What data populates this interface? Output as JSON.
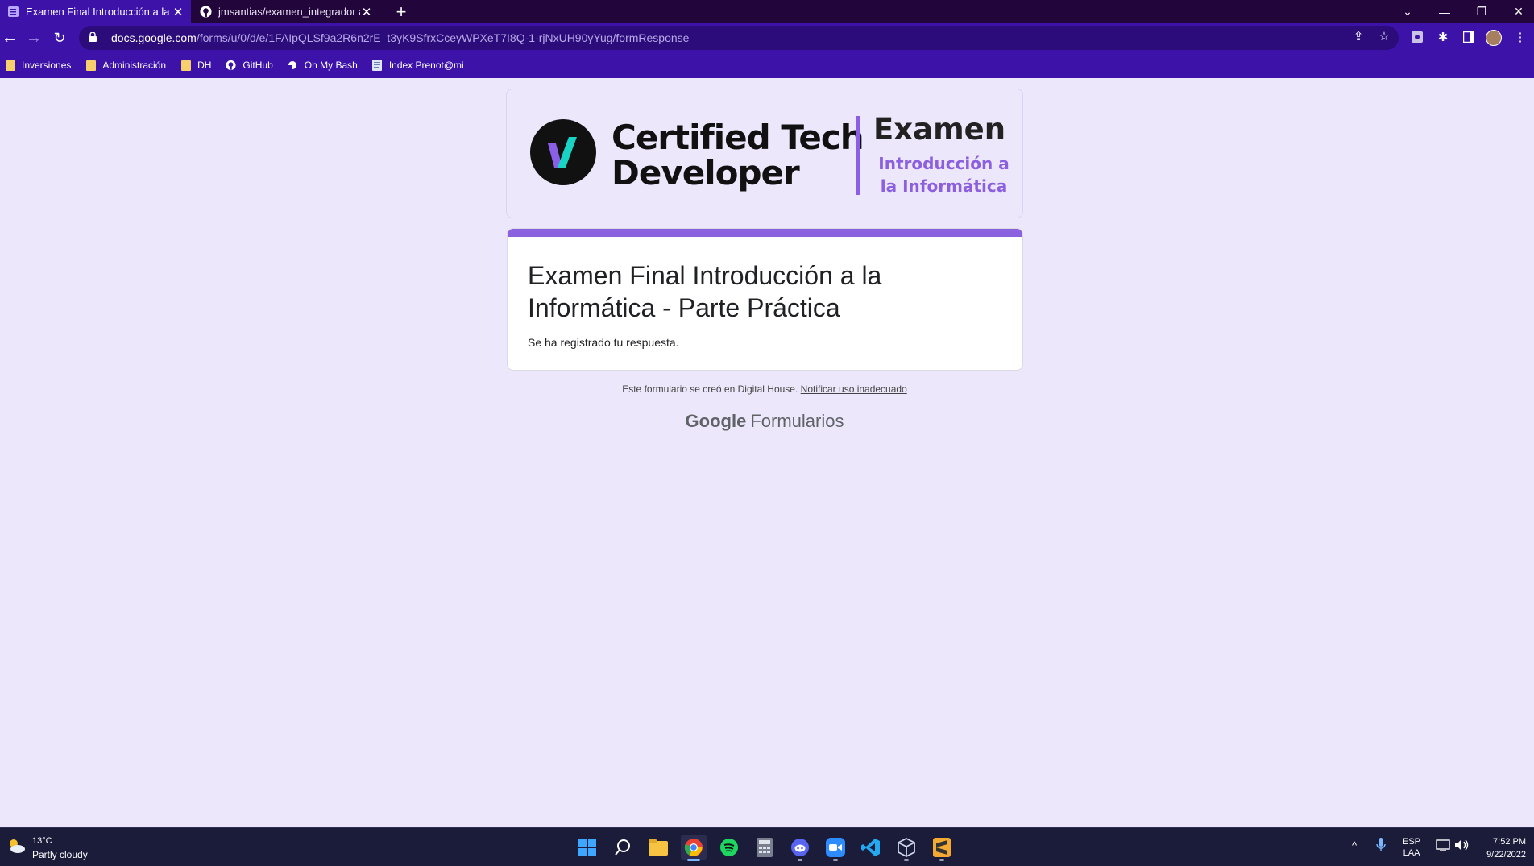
{
  "browser": {
    "tabs": [
      {
        "title": "Examen Final Introducción a la In",
        "icon": "google-forms-icon",
        "active": true
      },
      {
        "title": "jmsantias/examen_integrador at ",
        "icon": "github-icon",
        "active": false
      }
    ],
    "address": {
      "host": "docs.google.com",
      "path": "/forms/u/0/d/e/1FAIpQLSf9a2R6n2rE_t3yK9SfrxCceyWPXeT7I8Q-1-rjNxUH90yYug/formResponse"
    },
    "bookmarks": [
      {
        "label": "Inversiones",
        "icon": "folder-icon"
      },
      {
        "label": "Administración",
        "icon": "folder-icon"
      },
      {
        "label": "DH",
        "icon": "folder-icon"
      },
      {
        "label": "GitHub",
        "icon": "github-icon"
      },
      {
        "label": "Oh My Bash",
        "icon": "bash-icon"
      },
      {
        "label": "Index Prenot@mi",
        "icon": "page-icon"
      }
    ],
    "colors": {
      "tabstrip": "#22053b",
      "toolbar": "#3c12a9",
      "omnibox": "#2c0c7a"
    }
  },
  "banner": {
    "brand_line1": "Certified Tech",
    "brand_line2": "Developer",
    "exam_title": "Examen",
    "exam_subtitle": "Introducción a la Informática",
    "accent": "#8a5fe6"
  },
  "form": {
    "title": "Examen Final Introducción a la Informática - Parte Práctica",
    "confirmation": "Se ha registrado tu respuesta.",
    "footer_text": "Este formulario se creó en Digital House.",
    "footer_link": "Notificar uso inadecuado",
    "brand_google": "Google",
    "brand_product": "Formularios",
    "accent": "#8a62e0"
  },
  "taskbar": {
    "weather_temp": "13°C",
    "weather_desc": "Partly cloudy",
    "language_line1": "ESP",
    "language_line2": "LAA",
    "time": "7:52 PM",
    "date": "9/22/2022",
    "apps": [
      "start-icon",
      "search-icon",
      "file-explorer-icon",
      "chrome-icon",
      "spotify-icon",
      "calculator-icon",
      "discord-icon",
      "zoom-icon",
      "vscode-icon",
      "virtualbox-icon",
      "sublime-icon"
    ]
  }
}
